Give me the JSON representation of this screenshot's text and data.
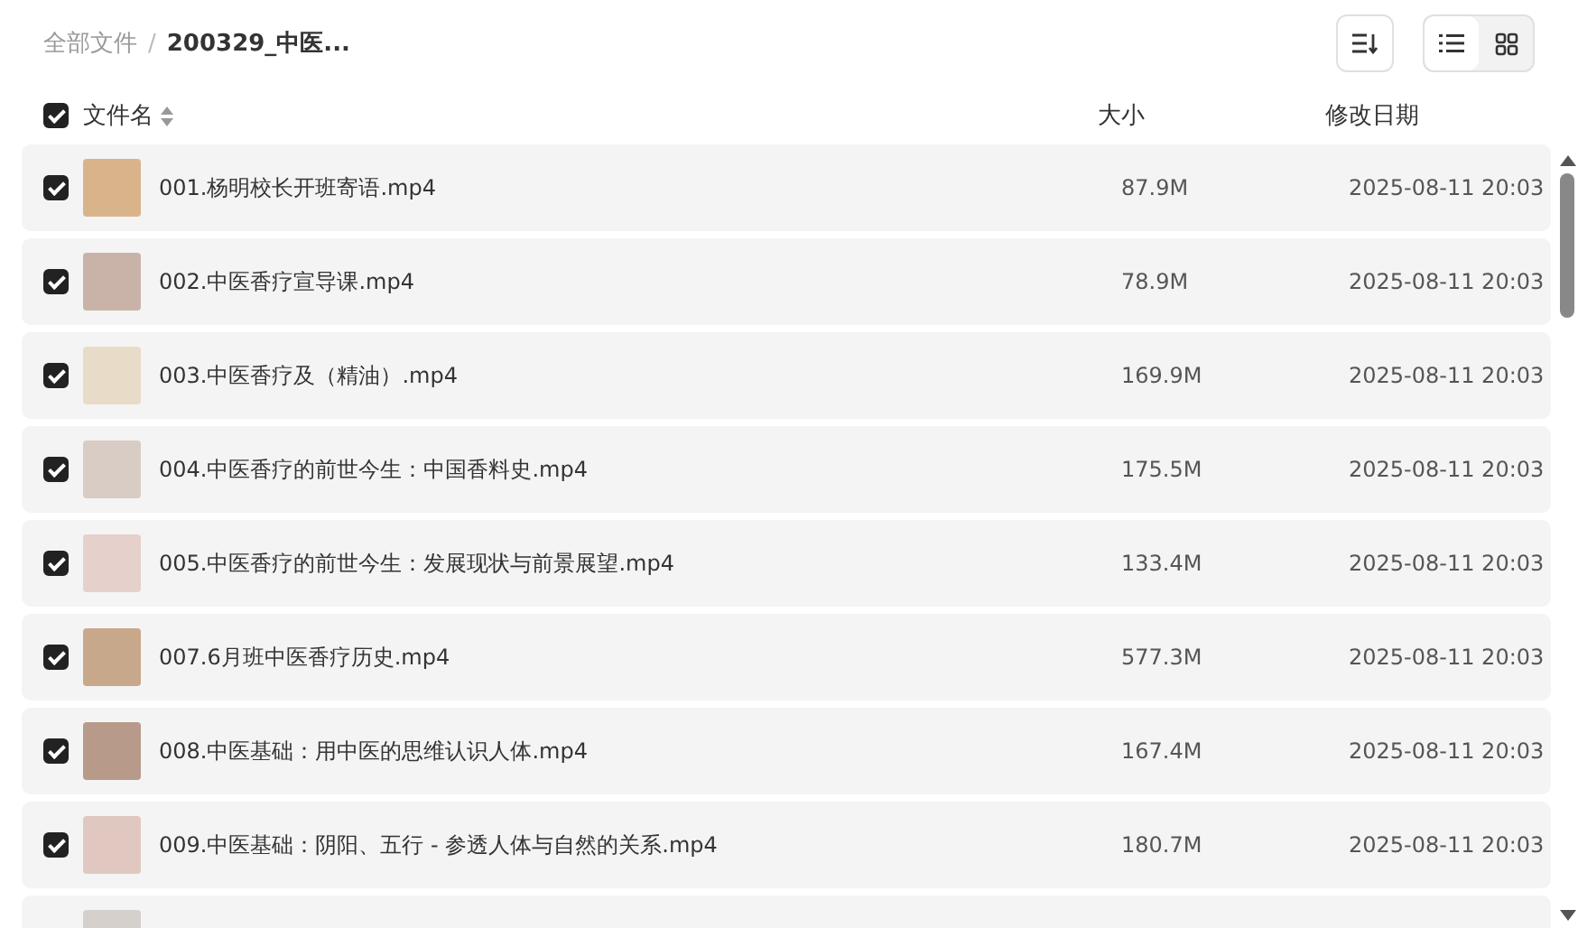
{
  "breadcrumb": {
    "root": "全部文件",
    "separator": "/",
    "current": "200329_中医..."
  },
  "view_toggle": [
    {
      "kind": "list",
      "selected": true
    },
    {
      "kind": "grid",
      "selected": false
    }
  ],
  "columns": {
    "select_all": true,
    "name": "文件名",
    "size": "大小",
    "date": "修改日期"
  },
  "rows": [
    {
      "checked": true,
      "name": "001.杨明校长开班寄语.mp4",
      "size": "87.9M",
      "date": "2025-08-11 20:03"
    },
    {
      "checked": true,
      "name": "002.中医香疗宣导课.mp4",
      "size": "78.9M",
      "date": "2025-08-11 20:03"
    },
    {
      "checked": true,
      "name": "003.中医香疗及（精油）.mp4",
      "size": "169.9M",
      "date": "2025-08-11 20:03"
    },
    {
      "checked": true,
      "name": "004.中医香疗的前世今生：中国香料史.mp4",
      "size": "175.5M",
      "date": "2025-08-11 20:03"
    },
    {
      "checked": true,
      "name": "005.中医香疗的前世今生：发展现状与前景展望.mp4",
      "size": "133.4M",
      "date": "2025-08-11 20:03"
    },
    {
      "checked": true,
      "name": "007.6月班中医香疗历史.mp4",
      "size": "577.3M",
      "date": "2025-08-11 20:03"
    },
    {
      "checked": true,
      "name": "008.中医基础：用中医的思维认识人体.mp4",
      "size": "167.4M",
      "date": "2025-08-11 20:03"
    },
    {
      "checked": true,
      "name": "009.中医基础：阴阳、五行 - 参透人体与自然的关系.mp4",
      "size": "180.7M",
      "date": "2025-08-11 20:03"
    }
  ]
}
